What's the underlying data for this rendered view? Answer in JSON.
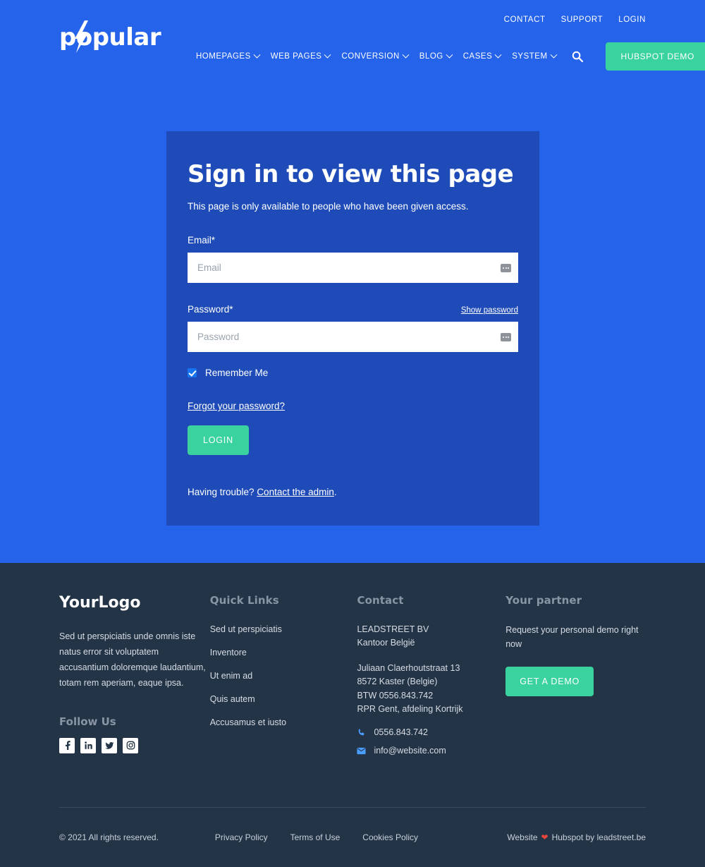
{
  "header": {
    "logo_text": "popular",
    "logo_icon": "lightning-bolt-icon",
    "top_links": [
      "CONTACT",
      "SUPPORT",
      "LOGIN"
    ],
    "nav_items": [
      {
        "label": "HOMEPAGES",
        "has_dropdown": true
      },
      {
        "label": "WEB PAGES",
        "has_dropdown": true
      },
      {
        "label": "CONVERSION",
        "has_dropdown": true
      },
      {
        "label": "BLOG",
        "has_dropdown": true
      },
      {
        "label": "CASES",
        "has_dropdown": true
      },
      {
        "label": "SYSTEM",
        "has_dropdown": true
      }
    ],
    "search_icon": "search-icon",
    "cta_label": "HUBSPOT DEMO"
  },
  "login_card": {
    "title": "Sign in to view this page",
    "subtitle": "This page is only available to people who have been given access.",
    "email_label": "Email*",
    "email_placeholder": "Email",
    "email_value": "",
    "password_label": "Password*",
    "password_placeholder": "Password",
    "password_value": "",
    "show_password_label": "Show password",
    "remember_label": "Remember Me",
    "remember_checked": true,
    "forgot_label": "Forgot your password?",
    "login_button": "LOGIN",
    "trouble_prefix": "Having trouble? ",
    "trouble_link": "Contact the admin",
    "trouble_suffix": "."
  },
  "footer": {
    "brand": "YourLogo",
    "brand_desc": "Sed ut perspiciatis unde omnis iste natus error sit voluptatem accusantium doloremque laudantium, totam rem aperiam, eaque ipsa.",
    "follow_heading": "Follow Us",
    "socials": [
      "facebook-icon",
      "linkedin-icon",
      "twitter-icon",
      "instagram-icon"
    ],
    "quick_links_heading": "Quick Links",
    "quick_links": [
      "Sed ut perspiciatis",
      "Inventore",
      "Ut enim ad",
      "Quis autem",
      "Accusamus et iusto"
    ],
    "contact_heading": "Contact",
    "company_name": "LEADSTREET BV",
    "company_office": "Kantoor België",
    "address_line_1": "Juliaan Claerhoutstraat 13",
    "address_line_2": "8572 Kaster (Belgie)",
    "address_line_3": "BTW 0556.843.742",
    "address_line_4": "RPR Gent, afdeling Kortrijk",
    "phone": "0556.843.742",
    "email": "info@website.com",
    "partner_heading": "Your partner",
    "partner_text": "Request your personal demo right now",
    "partner_button": "GET A DEMO",
    "copyright": "© 2021 All rights reserved.",
    "bottom_links": [
      "Privacy Policy",
      "Terms of Use",
      "Cookies Policy"
    ],
    "credit_prefix": "Website",
    "credit_heart": "❤",
    "credit_suffix": "Hubspot by leadstreet.be"
  },
  "colors": {
    "page_blue": "#2563eb",
    "card_blue": "#1e4bb8",
    "green": "#3ad29f",
    "footer_navy": "#243447",
    "heart_red": "#e8453c"
  }
}
